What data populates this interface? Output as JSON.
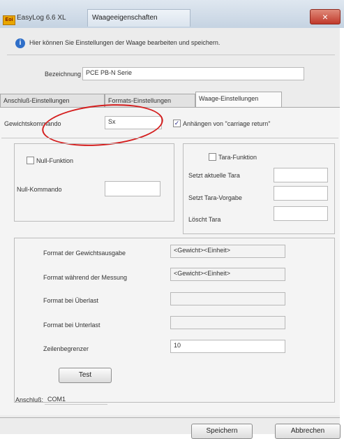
{
  "window": {
    "app_title": "EasyLog 6.6 XL",
    "app_icon_label": "Eoi",
    "tab_title": "Waageeigenschaften",
    "close_glyph": "×"
  },
  "info": {
    "text": "Hier können Sie Einstellungen der Waage bearbeiten und speichern."
  },
  "bezeichnung": {
    "label": "Bezeichnung",
    "value": "PCE PB-N Serie"
  },
  "tabs": [
    {
      "label": "Anschluß-Einstellungen",
      "active": false
    },
    {
      "label": "Formats-Einstellungen",
      "active": false
    },
    {
      "label": "Waage-Einstellungen",
      "active": true
    }
  ],
  "gewichtskommando": {
    "label": "Gewichtskommando",
    "value": "Sx",
    "append_checked": true,
    "append_label": "Anhängen von \"carriage return\""
  },
  "null_group": {
    "checkbox_label": "Null-Funktion",
    "checked": false,
    "command_label": "Null-Kommando",
    "command_value": ""
  },
  "tara_group": {
    "checkbox_label": "Tara-Funktion",
    "checked": false,
    "rows": [
      {
        "label": "Setzt aktuelle Tara",
        "value": ""
      },
      {
        "label": "Setzt Tara-Vorgabe",
        "value": ""
      },
      {
        "label": "Löscht Tara",
        "value": ""
      }
    ]
  },
  "format_group": {
    "rows": [
      {
        "label": "Format der Gewichtsausgabe",
        "value": "<Gewicht><Einheit>"
      },
      {
        "label": "Format während der Messung",
        "value": "<Gewicht><Einheit>"
      },
      {
        "label": "Format bei Überlast",
        "value": ""
      },
      {
        "label": "Format bei Unterlast",
        "value": ""
      },
      {
        "label": "Zeilenbegrenzer",
        "value": "10"
      }
    ]
  },
  "test_button": "Test",
  "anschluss": {
    "label": "Anschluß:",
    "value": "COM1"
  },
  "footer": {
    "save": "Speichern",
    "cancel": "Abbrechen"
  },
  "colors": {
    "annotation_ellipse": "#d41e1e",
    "info_icon": "#2f6fc9",
    "close_button": "#c0392b"
  }
}
